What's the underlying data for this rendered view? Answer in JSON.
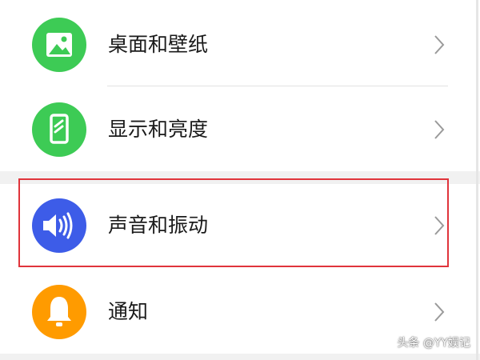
{
  "settings": {
    "items": [
      {
        "label": "桌面和壁纸",
        "icon": "image-icon",
        "color": "#3dcb55"
      },
      {
        "label": "显示和亮度",
        "icon": "phone-display-icon",
        "color": "#3dcb55"
      },
      {
        "label": "声音和振动",
        "icon": "speaker-icon",
        "color": "#3d5ce8"
      },
      {
        "label": "通知",
        "icon": "bell-icon",
        "color": "#ff9b00"
      }
    ],
    "highlight_color": "#e0343b"
  },
  "watermark": "头条 @YY娱记"
}
